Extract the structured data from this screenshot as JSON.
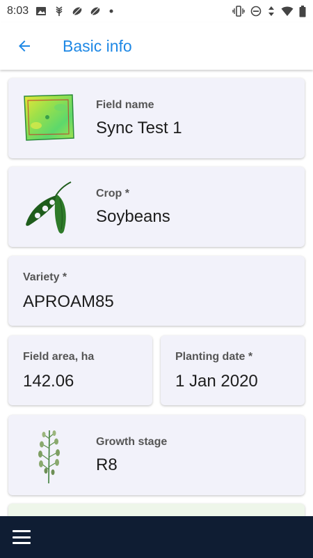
{
  "status_bar": {
    "time": "8:03",
    "left_icons": [
      "image-icon",
      "wheat-icon",
      "leaf-icon",
      "leaf-icon",
      "dot-icon"
    ],
    "right_icons": [
      "vibrate-icon",
      "do-not-disturb-icon",
      "data-arrows-icon",
      "wifi-icon",
      "battery-icon"
    ]
  },
  "app_bar": {
    "title": "Basic info",
    "back_icon": "arrow-back-icon",
    "accent_color": "#1e88e5"
  },
  "cards": {
    "field_name": {
      "label": "Field name",
      "value": "Sync Test 1",
      "icon": "field-map-icon"
    },
    "crop": {
      "label": "Crop *",
      "value": "Soybeans",
      "icon": "soybean-pod-icon"
    },
    "variety": {
      "label": "Variety *",
      "value": "APROAM85"
    },
    "field_area": {
      "label": "Field area, ha",
      "value": "142.06"
    },
    "planting_date": {
      "label": "Planting date *",
      "value": "1 Jan 2020"
    },
    "growth_stage": {
      "label": "Growth stage",
      "value": "R8",
      "icon": "plant-stage-icon"
    }
  },
  "bottom_bar": {
    "menu_icon": "hamburger-menu-icon",
    "background": "#0f1d33"
  }
}
